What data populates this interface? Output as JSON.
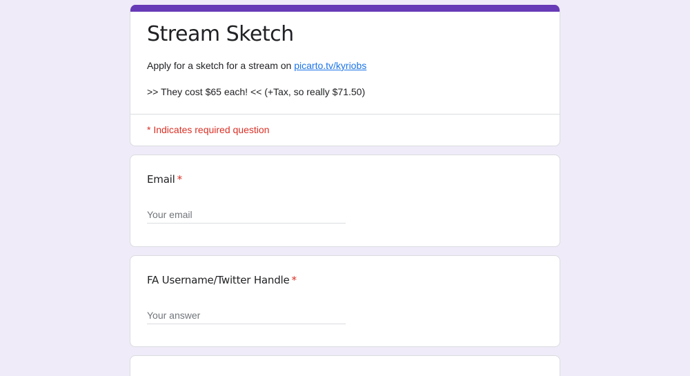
{
  "form": {
    "title": "Stream Sketch",
    "description_prefix": "Apply for a sketch for a stream on ",
    "description_link": "picarto.tv/kyriobs",
    "price_line": ">> They cost $65 each! << (+Tax, so really $71.50)",
    "required_note": "* Indicates required question",
    "accent_color": "#673ab7",
    "background_color": "#efebf8"
  },
  "questions": [
    {
      "title": "Email",
      "required_marker": "*",
      "placeholder": "Your email"
    },
    {
      "title": "FA Username/Twitter Handle",
      "required_marker": "*",
      "placeholder": "Your answer"
    }
  ]
}
